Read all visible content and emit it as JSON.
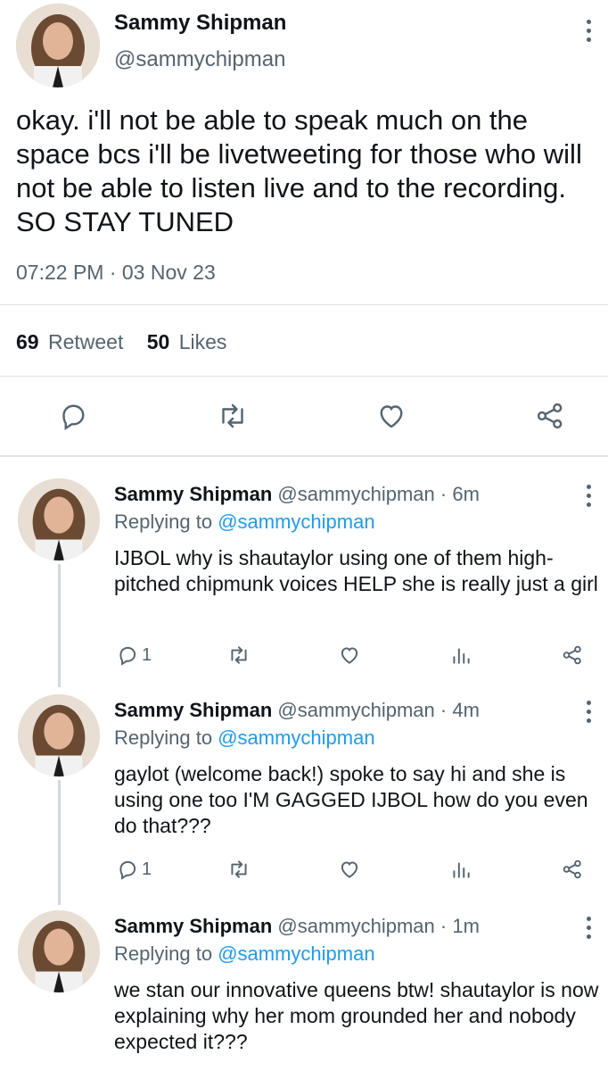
{
  "main_tweet": {
    "name": "Sammy Shipman",
    "handle": "@sammychipman",
    "text": "okay. i'll not be able to speak much on the space bcs i'll be livetweeting for those who will not be able to listen live and to the recording. SO STAY TUNED",
    "timestamp": "07:22 PM · 03 Nov 23",
    "retweet_count": "69",
    "retweet_label": "Retweet",
    "likes_count": "50",
    "likes_label": "Likes",
    "actions": [
      "reply-icon",
      "retweet-icon",
      "like-icon",
      "share-icon"
    ]
  },
  "replies": [
    {
      "name": "Sammy Shipman",
      "handle": "@sammychipman",
      "time": "· 6m",
      "replying_label": "Replying to",
      "replying_to": "@sammychipman",
      "text": "IJBOL why is shautaylor using one of them high-pitched chipmunk voices HELP she is really just a girl",
      "reply_count": "1"
    },
    {
      "name": "Sammy Shipman",
      "handle": "@sammychipman",
      "time": "· 4m",
      "replying_label": "Replying to",
      "replying_to": "@sammychipman",
      "text": "gaylot (welcome back!) spoke to say hi and she is using one too I'M GAGGED IJBOL how do you even do that???",
      "reply_count": "1"
    },
    {
      "name": "Sammy Shipman",
      "handle": "@sammychipman",
      "time": "· 1m",
      "replying_label": "Replying to",
      "replying_to": "@sammychipman",
      "text": "we stan our innovative queens btw! shautaylor is now explaining why her mom grounded her and nobody expected it???",
      "reply_count": ""
    }
  ],
  "colors": {
    "text": "#0f1419",
    "muted": "#536471",
    "link": "#1d9bf0",
    "divider": "#dfe3e6"
  }
}
